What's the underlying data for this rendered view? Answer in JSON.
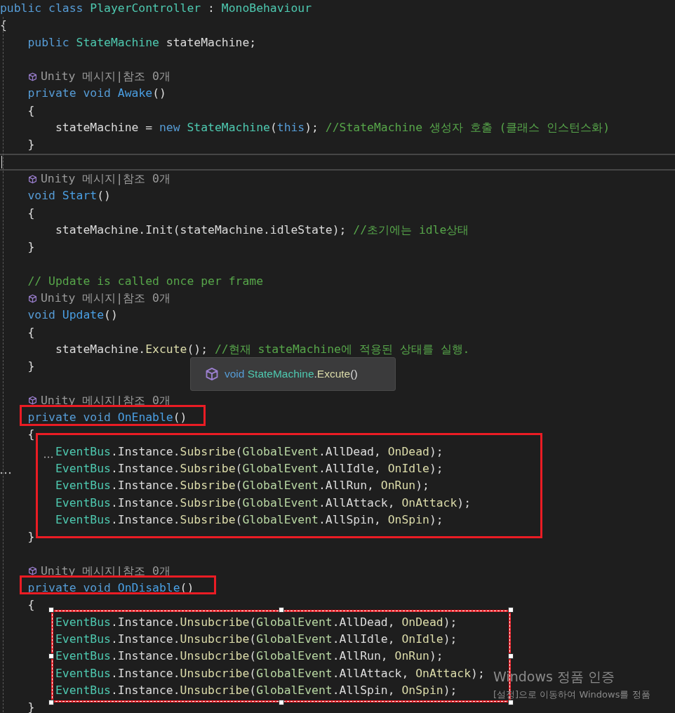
{
  "editor": {
    "lines": [
      {
        "kind": "code",
        "tokens": [
          {
            "text": "public class ",
            "kind": "kw"
          },
          {
            "text": "PlayerController",
            "kind": "type"
          },
          {
            "text": " : ",
            "kind": "plain"
          },
          {
            "text": "MonoBehaviour",
            "kind": "type"
          }
        ]
      },
      {
        "kind": "code",
        "tokens": [
          {
            "text": "{",
            "kind": "plain"
          }
        ]
      },
      {
        "kind": "code",
        "tokens": [
          {
            "text": "    public ",
            "kind": "kw"
          },
          {
            "text": "StateMachine",
            "kind": "type"
          },
          {
            "text": " stateMachine;",
            "kind": "plain"
          }
        ]
      },
      {
        "kind": "blank"
      },
      {
        "kind": "lens",
        "text": "Unity 메시지|참조 0개"
      },
      {
        "kind": "code",
        "tokens": [
          {
            "text": "    private void ",
            "kind": "kw"
          },
          {
            "text": "Awake",
            "kind": "decl"
          },
          {
            "text": "()",
            "kind": "plain"
          }
        ]
      },
      {
        "kind": "code",
        "tokens": [
          {
            "text": "    {",
            "kind": "plain"
          }
        ]
      },
      {
        "kind": "code",
        "tokens": [
          {
            "text": "        stateMachine = ",
            "kind": "plain"
          },
          {
            "text": "new ",
            "kind": "kw"
          },
          {
            "text": "StateMachine",
            "kind": "type"
          },
          {
            "text": "(",
            "kind": "plain"
          },
          {
            "text": "this",
            "kind": "kw"
          },
          {
            "text": "); ",
            "kind": "plain"
          },
          {
            "text": "//StateMachine 생성자 호출 (클래스 인스턴스화)",
            "kind": "comment"
          }
        ]
      },
      {
        "kind": "code",
        "tokens": [
          {
            "text": "    }",
            "kind": "plain"
          }
        ]
      },
      {
        "kind": "current"
      },
      {
        "kind": "lens",
        "text": "Unity 메시지|참조 0개"
      },
      {
        "kind": "code",
        "tokens": [
          {
            "text": "    void ",
            "kind": "kw"
          },
          {
            "text": "Start",
            "kind": "decl"
          },
          {
            "text": "()",
            "kind": "plain"
          }
        ]
      },
      {
        "kind": "code",
        "tokens": [
          {
            "text": "    {",
            "kind": "plain"
          }
        ]
      },
      {
        "kind": "code",
        "tokens": [
          {
            "text": "        stateMachine.Init(stateMachine.idleState); ",
            "kind": "plain"
          },
          {
            "text": "//초기에는 idle상태",
            "kind": "comment"
          }
        ]
      },
      {
        "kind": "code",
        "tokens": [
          {
            "text": "    }",
            "kind": "plain"
          }
        ]
      },
      {
        "kind": "blank"
      },
      {
        "kind": "code",
        "tokens": [
          {
            "text": "    // Update is called once per frame",
            "kind": "comment"
          }
        ]
      },
      {
        "kind": "lens",
        "text": "Unity 메시지|참조 0개"
      },
      {
        "kind": "code",
        "tokens": [
          {
            "text": "    void ",
            "kind": "kw"
          },
          {
            "text": "Update",
            "kind": "decl"
          },
          {
            "text": "()",
            "kind": "plain"
          }
        ]
      },
      {
        "kind": "code",
        "tokens": [
          {
            "text": "    {",
            "kind": "plain"
          }
        ]
      },
      {
        "kind": "code",
        "tokens": [
          {
            "text": "        stateMachine.",
            "kind": "plain"
          },
          {
            "text": "Excute",
            "kind": "method"
          },
          {
            "text": "(); ",
            "kind": "plain"
          },
          {
            "text": "//현재 stateMachine에 적용된 상태를 실행.",
            "kind": "comment"
          }
        ]
      },
      {
        "kind": "code",
        "tokens": [
          {
            "text": "    }",
            "kind": "plain"
          }
        ]
      },
      {
        "kind": "blank"
      },
      {
        "kind": "lens",
        "text": "Unity 메시지|참조 0개"
      },
      {
        "kind": "code",
        "tokens": [
          {
            "text": "    private void ",
            "kind": "kw"
          },
          {
            "text": "OnEnable",
            "kind": "decl"
          },
          {
            "text": "()",
            "kind": "plain"
          }
        ]
      },
      {
        "kind": "code",
        "tokens": [
          {
            "text": "    {",
            "kind": "plain"
          }
        ]
      },
      {
        "kind": "code",
        "tokens": [
          {
            "text": "        EventBus",
            "kind": "type"
          },
          {
            "text": ".Instance.",
            "kind": "plain"
          },
          {
            "text": "Subsribe",
            "kind": "method"
          },
          {
            "text": "(",
            "kind": "plain"
          },
          {
            "text": "GlobalEvent",
            "kind": "enum"
          },
          {
            "text": ".AllDead, ",
            "kind": "plain"
          },
          {
            "text": "OnDead",
            "kind": "method"
          },
          {
            "text": ");",
            "kind": "plain"
          }
        ]
      },
      {
        "kind": "code",
        "tokens": [
          {
            "text": "        EventBus",
            "kind": "type"
          },
          {
            "text": ".Instance.",
            "kind": "plain"
          },
          {
            "text": "Subsribe",
            "kind": "method"
          },
          {
            "text": "(",
            "kind": "plain"
          },
          {
            "text": "GlobalEvent",
            "kind": "enum"
          },
          {
            "text": ".AllIdle, ",
            "kind": "plain"
          },
          {
            "text": "OnIdle",
            "kind": "method"
          },
          {
            "text": ");",
            "kind": "plain"
          }
        ]
      },
      {
        "kind": "code",
        "tokens": [
          {
            "text": "        EventBus",
            "kind": "type"
          },
          {
            "text": ".Instance.",
            "kind": "plain"
          },
          {
            "text": "Subsribe",
            "kind": "method"
          },
          {
            "text": "(",
            "kind": "plain"
          },
          {
            "text": "GlobalEvent",
            "kind": "enum"
          },
          {
            "text": ".AllRun, ",
            "kind": "plain"
          },
          {
            "text": "OnRun",
            "kind": "method"
          },
          {
            "text": ");",
            "kind": "plain"
          }
        ]
      },
      {
        "kind": "code",
        "tokens": [
          {
            "text": "        EventBus",
            "kind": "type"
          },
          {
            "text": ".Instance.",
            "kind": "plain"
          },
          {
            "text": "Subsribe",
            "kind": "method"
          },
          {
            "text": "(",
            "kind": "plain"
          },
          {
            "text": "GlobalEvent",
            "kind": "enum"
          },
          {
            "text": ".AllAttack, ",
            "kind": "plain"
          },
          {
            "text": "OnAttack",
            "kind": "method"
          },
          {
            "text": ");",
            "kind": "plain"
          }
        ]
      },
      {
        "kind": "code",
        "tokens": [
          {
            "text": "        EventBus",
            "kind": "type"
          },
          {
            "text": ".Instance.",
            "kind": "plain"
          },
          {
            "text": "Subsribe",
            "kind": "method"
          },
          {
            "text": "(",
            "kind": "plain"
          },
          {
            "text": "GlobalEvent",
            "kind": "enum"
          },
          {
            "text": ".AllSpin, ",
            "kind": "plain"
          },
          {
            "text": "OnSpin",
            "kind": "method"
          },
          {
            "text": ");",
            "kind": "plain"
          }
        ]
      },
      {
        "kind": "code",
        "tokens": [
          {
            "text": "    }",
            "kind": "plain"
          }
        ]
      },
      {
        "kind": "blank"
      },
      {
        "kind": "lens",
        "text": "Unity 메시지|참조 0개"
      },
      {
        "kind": "code",
        "tokens": [
          {
            "text": "    private void ",
            "kind": "kw"
          },
          {
            "text": "OnDisable",
            "kind": "decl"
          },
          {
            "text": "()",
            "kind": "plain"
          }
        ]
      },
      {
        "kind": "code",
        "tokens": [
          {
            "text": "    {",
            "kind": "plain"
          }
        ]
      },
      {
        "kind": "code",
        "tokens": [
          {
            "text": "        EventBus",
            "kind": "type"
          },
          {
            "text": ".Instance.",
            "kind": "plain"
          },
          {
            "text": "Unsubcribe",
            "kind": "method"
          },
          {
            "text": "(",
            "kind": "plain"
          },
          {
            "text": "GlobalEvent",
            "kind": "enum"
          },
          {
            "text": ".AllDead, ",
            "kind": "plain"
          },
          {
            "text": "OnDead",
            "kind": "method"
          },
          {
            "text": ");",
            "kind": "plain"
          }
        ]
      },
      {
        "kind": "code",
        "tokens": [
          {
            "text": "        EventBus",
            "kind": "type"
          },
          {
            "text": ".Instance.",
            "kind": "plain"
          },
          {
            "text": "Unsubcribe",
            "kind": "method"
          },
          {
            "text": "(",
            "kind": "plain"
          },
          {
            "text": "GlobalEvent",
            "kind": "enum"
          },
          {
            "text": ".AllIdle, ",
            "kind": "plain"
          },
          {
            "text": "OnIdle",
            "kind": "method"
          },
          {
            "text": ");",
            "kind": "plain"
          }
        ]
      },
      {
        "kind": "code",
        "tokens": [
          {
            "text": "        EventBus",
            "kind": "type"
          },
          {
            "text": ".Instance.",
            "kind": "plain"
          },
          {
            "text": "Unsubcribe",
            "kind": "method"
          },
          {
            "text": "(",
            "kind": "plain"
          },
          {
            "text": "GlobalEvent",
            "kind": "enum"
          },
          {
            "text": ".AllRun, ",
            "kind": "plain"
          },
          {
            "text": "OnRun",
            "kind": "method"
          },
          {
            "text": ");",
            "kind": "plain"
          }
        ]
      },
      {
        "kind": "code",
        "tokens": [
          {
            "text": "        EventBus",
            "kind": "type"
          },
          {
            "text": ".Instance.",
            "kind": "plain"
          },
          {
            "text": "Unsubcribe",
            "kind": "method"
          },
          {
            "text": "(",
            "kind": "plain"
          },
          {
            "text": "GlobalEvent",
            "kind": "enum"
          },
          {
            "text": ".AllAttack, ",
            "kind": "plain"
          },
          {
            "text": "OnAttack",
            "kind": "method"
          },
          {
            "text": ");",
            "kind": "plain"
          }
        ]
      },
      {
        "kind": "code",
        "tokens": [
          {
            "text": "        EventBus",
            "kind": "type"
          },
          {
            "text": ".Instance.",
            "kind": "plain"
          },
          {
            "text": "Unsubcribe",
            "kind": "method"
          },
          {
            "text": "(",
            "kind": "plain"
          },
          {
            "text": "GlobalEvent",
            "kind": "enum"
          },
          {
            "text": ".AllSpin, ",
            "kind": "plain"
          },
          {
            "text": "OnSpin",
            "kind": "method"
          },
          {
            "text": ");",
            "kind": "plain"
          }
        ]
      },
      {
        "kind": "code",
        "tokens": [
          {
            "text": "    }",
            "kind": "plain"
          }
        ]
      }
    ]
  },
  "tooltip": {
    "tokens": [
      {
        "text": "void ",
        "kind": "kw"
      },
      {
        "text": "StateMachine",
        "kind": "type"
      },
      {
        "text": ".",
        "kind": "plain"
      },
      {
        "text": "Excute",
        "kind": "method"
      },
      {
        "text": "()",
        "kind": "plain"
      }
    ]
  },
  "annotations": [
    {
      "selected": false
    },
    {
      "selected": false
    },
    {
      "selected": false
    },
    {
      "selected": true
    }
  ],
  "activation": {
    "title": "Windows 정품 인증",
    "message": "[설정]으로 이동하여 Windows를 정품"
  }
}
